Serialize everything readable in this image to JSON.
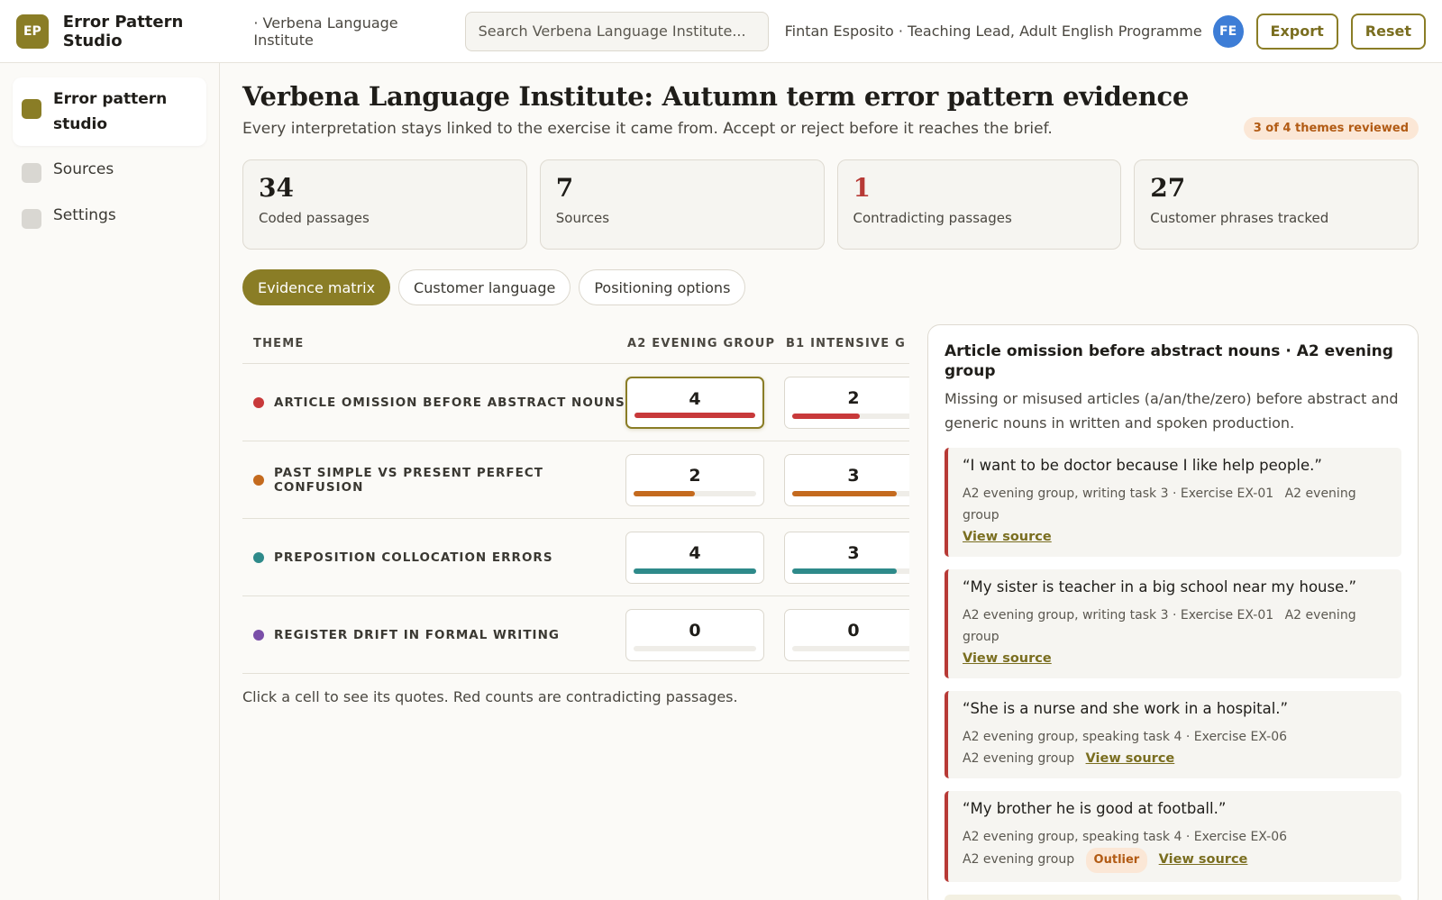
{
  "app": {
    "logo": "EP",
    "title": "Error Pattern Studio",
    "org": "· Verbena Language Institute",
    "search_placeholder": "Search Verbena Language Institute...",
    "user": "Fintan Esposito · Teaching Lead, Adult English Programme",
    "avatar": "FE",
    "export_label": "Export",
    "reset_label": "Reset"
  },
  "sidebar": {
    "items": [
      {
        "label": "Error pattern studio",
        "active": true
      },
      {
        "label": "Sources",
        "active": false
      },
      {
        "label": "Settings",
        "active": false
      }
    ]
  },
  "page": {
    "title": "Verbena Language Institute: Autumn term error pattern evidence",
    "subtitle": "Every interpretation stays linked to the exercise it came from. Accept or reject before it reaches the brief.",
    "review_status": "3 of 4 themes reviewed"
  },
  "stats": [
    {
      "value": "34",
      "label": "Coded passages"
    },
    {
      "value": "7",
      "label": "Sources"
    },
    {
      "value": "1",
      "label": "Contradicting passages"
    },
    {
      "value": "27",
      "label": "Customer phrases tracked"
    }
  ],
  "tabs": [
    {
      "label": "Evidence matrix",
      "active": true
    },
    {
      "label": "Customer language",
      "active": false
    },
    {
      "label": "Positioning options",
      "active": false
    }
  ],
  "matrix": {
    "headers": {
      "theme": "THEME",
      "col1": "A2 EVENING GROUP",
      "col2": "B1 INTENSIVE G"
    },
    "rows": [
      {
        "theme": "ARTICLE OMISSION BEFORE ABSTRACT NOUNS",
        "color": "#c8393a",
        "c1": "4",
        "c1_fill": 1.0,
        "c2": "2",
        "c2_fill": 0.55
      },
      {
        "theme": "PAST SIMPLE VS PRESENT PERFECT CONFUSION",
        "color": "#c46a1e",
        "c1": "2",
        "c1_fill": 0.5,
        "c2": "3",
        "c2_fill": 0.85
      },
      {
        "theme": "PREPOSITION COLLOCATION ERRORS",
        "color": "#2e8a8a",
        "c1": "4",
        "c1_fill": 1.0,
        "c2": "3",
        "c2_fill": 0.85
      },
      {
        "theme": "REGISTER DRIFT IN FORMAL WRITING",
        "color": "#7a4fa8",
        "c1": "0",
        "c1_fill": 0,
        "c2": "0",
        "c2_fill": 0
      }
    ],
    "hint": "Click a cell to see its quotes. Red counts are contradicting passages."
  },
  "detail": {
    "title": "Article omission before abstract nouns · A2 evening group",
    "description": "Missing or misused articles (a/an/the/zero) before abstract and generic nouns in written and spoken production.",
    "quotes": [
      {
        "text": "“I want to be doctor because I like help people.”",
        "source": "A2 evening group, writing task 3 · Exercise EX-01",
        "group": "A2 evening group",
        "link": "View source"
      },
      {
        "text": "“My sister is teacher in a big school near my house.”",
        "source": "A2 evening group, writing task 3 · Exercise EX-01",
        "group": "A2 evening group",
        "link": "View source"
      },
      {
        "text": "“She is a nurse and she work in a hospital.”",
        "source": "A2 evening group, speaking task 4 · Exercise EX-06",
        "group": "A2 evening group",
        "link": "View source"
      },
      {
        "text": "“My brother he is good at football.”",
        "source": "A2 evening group, speaking task 4 · Exercise EX-06",
        "group": "A2 evening group",
        "badge": "Outlier",
        "link": "View source"
      }
    ]
  }
}
